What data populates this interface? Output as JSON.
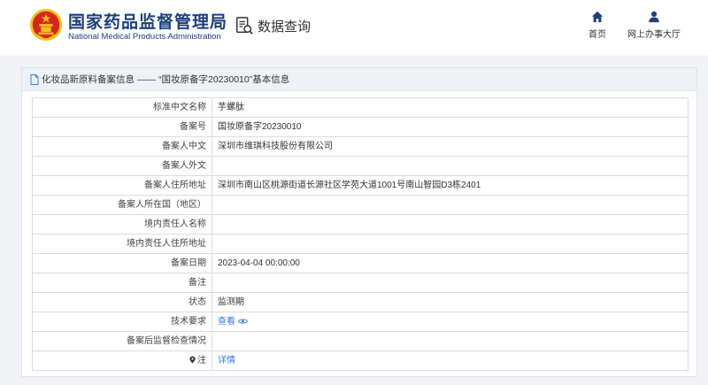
{
  "header": {
    "title_cn": "国家药品监督管理局",
    "title_en": "National Medical Products Administration",
    "module_title": "数据查询",
    "nav": [
      {
        "label": "首页",
        "icon": "home-icon"
      },
      {
        "label": "网上办事大厅",
        "icon": "user-icon"
      }
    ]
  },
  "panel": {
    "heading": "化妆品新原料备案信息",
    "separator": "——",
    "record_quote": "“国妆原备字20230010”",
    "heading_suffix": "基本信息"
  },
  "rows": [
    {
      "label": "标准中文名称",
      "value": "芋螺肽"
    },
    {
      "label": "备案号",
      "value": "国妆原备字20230010"
    },
    {
      "label": "备案人中文",
      "value": "深圳市维琪科技股份有限公司"
    },
    {
      "label": "备案人外文",
      "value": ""
    },
    {
      "label": "备案人住所地址",
      "value": "深圳市南山区桃源街道长源社区学苑大道1001号南山智园D3栋2401"
    },
    {
      "label": "备案人所在国（地区）",
      "value": ""
    },
    {
      "label": "境内责任人名称",
      "value": ""
    },
    {
      "label": "境内责任人住所地址",
      "value": ""
    },
    {
      "label": "备案日期",
      "value": "2023-04-04 00:00:00"
    },
    {
      "label": "备注",
      "value": ""
    },
    {
      "label": "状态",
      "value": "监测期"
    },
    {
      "label": "技术要求",
      "value": "查看"
    },
    {
      "label": "备案后监督检查情况",
      "value": ""
    },
    {
      "label": "注",
      "value": "详情"
    }
  ],
  "colors": {
    "brand_blue": "#1d3f7a",
    "link": "#3a7bd5",
    "emblem_red": "#d7261e",
    "emblem_gold": "#f3c01b"
  }
}
